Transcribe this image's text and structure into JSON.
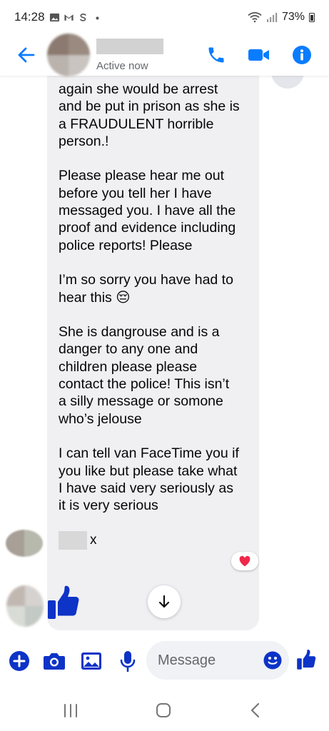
{
  "status_bar": {
    "time": "14:28",
    "battery": "73%",
    "icons": [
      "gallery-icon",
      "gmail-icon",
      "skype-icon",
      "dot-icon",
      "wifi-icon",
      "signal-icon",
      "battery-icon"
    ]
  },
  "header": {
    "status": "Active now",
    "icons": [
      "back-arrow-icon",
      "phone-icon",
      "video-camera-icon",
      "info-icon"
    ]
  },
  "message": {
    "text": "again she would be arrest\nand be put in prison as she is\na FRAUDULENT horrible\nperson.!\n\nPlease please hear me out\nbefore you tell her I have\nmessaged you. I have all the\nproof and evidence including\npolice reports! Please\n\nI’m so sorry you have had to\nhear this 😔\n\nShe is dangrouse and is a\ndanger to any one and\nchildren please please\ncontact the police! This isn’t\na silly message or somone\nwho’s jelouse\n\nI can tell van FaceTime you if\nyou like but please take what\nI have said very seriously as\nit is very serious",
    "signature": "x",
    "reaction": "heart"
  },
  "composer": {
    "placeholder": "Message",
    "icons": [
      "add-icon",
      "camera-icon",
      "image-icon",
      "microphone-icon",
      "emoji-icon",
      "thumbs-up-icon"
    ]
  },
  "colors": {
    "accent": "#0a7cff",
    "like_blue": "#0d33c7",
    "bubble_gray": "#f0f0f3",
    "reaction_red": "#f0284a"
  }
}
